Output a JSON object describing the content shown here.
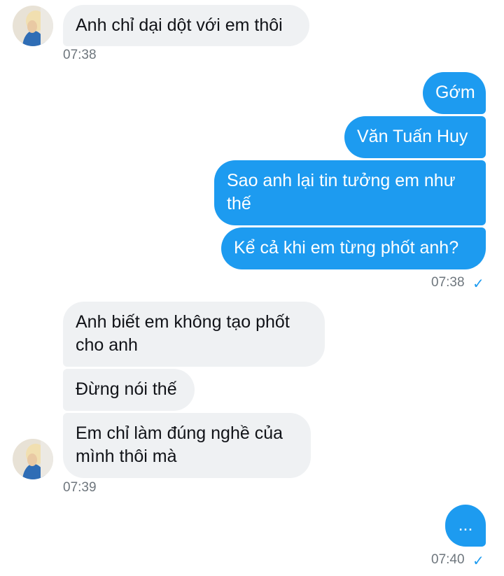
{
  "conversation": {
    "group1": {
      "messages": [
        "Anh chỉ dại dột với em thôi"
      ],
      "time": "07:38"
    },
    "group2": {
      "messages": [
        "Gớm",
        "Văn Tuấn Huy",
        "Sao anh lại tin tưởng em như thế",
        "Kể cả khi em từng phốt anh?"
      ],
      "time": "07:38",
      "read_icon": "checkmark-icon"
    },
    "group3": {
      "messages": [
        "Anh biết em không tạo phốt cho anh",
        "Đừng nói thế",
        "Em chỉ làm đúng nghề của mình thôi mà"
      ],
      "time": "07:39"
    },
    "group4": {
      "messages": [
        "..."
      ],
      "time": "07:40",
      "read_icon": "checkmark-icon"
    }
  },
  "check_glyph": "✓",
  "colors": {
    "outgoing_bubble": "#1d9bf0",
    "incoming_bubble": "#eff1f3",
    "timestamp": "#6e767d"
  }
}
